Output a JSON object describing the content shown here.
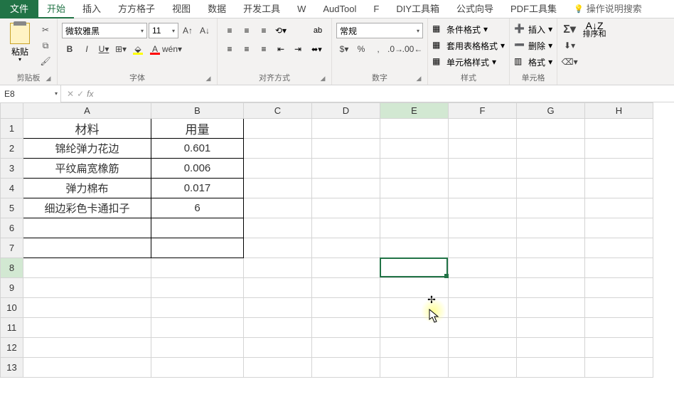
{
  "tabs": {
    "file": "文件",
    "home": "开始",
    "insert": "插入",
    "fgz": "方方格子",
    "view": "视图",
    "data": "数据",
    "dev": "开发工具",
    "w": "W",
    "audtool": "AudTool",
    "f": "F",
    "diy": "DIY工具箱",
    "fxguide": "公式向导",
    "pdf": "PDF工具集",
    "tell": "操作说明搜索"
  },
  "ribbon": {
    "clipboard": {
      "paste": "粘贴",
      "label": "剪贴板"
    },
    "font": {
      "name": "微软雅黑",
      "size": "11",
      "label": "字体",
      "bold": "B",
      "italic": "I",
      "underline": "U",
      "pinyin": "wén"
    },
    "align": {
      "label": "对齐方式",
      "wrap": "ab"
    },
    "number": {
      "format": "常规",
      "label": "数字"
    },
    "styles": {
      "cond": "条件格式",
      "table": "套用表格格式",
      "cell": "单元格样式",
      "label": "样式"
    },
    "cells": {
      "insert": "插入",
      "delete": "删除",
      "format": "格式",
      "label": "单元格"
    },
    "editing": {
      "sort": "排序和",
      "label": ""
    }
  },
  "namebox": "E8",
  "fx": "fx",
  "formula": "",
  "columns": [
    "A",
    "B",
    "C",
    "D",
    "E",
    "F",
    "G",
    "H"
  ],
  "rows": [
    "1",
    "2",
    "3",
    "4",
    "5",
    "6",
    "7",
    "8",
    "9",
    "10",
    "11",
    "12",
    "13"
  ],
  "sheet": {
    "header": {
      "A": "材料",
      "B": "用量"
    },
    "data": [
      {
        "A": "锦纶弹力花边",
        "B": "0.601"
      },
      {
        "A": "平纹扁宽橡筋",
        "B": "0.006"
      },
      {
        "A": "弹力棉布",
        "B": "0.017"
      },
      {
        "A": "细边彩色卡通扣子",
        "B": "6"
      }
    ]
  },
  "active_cell": "E8"
}
